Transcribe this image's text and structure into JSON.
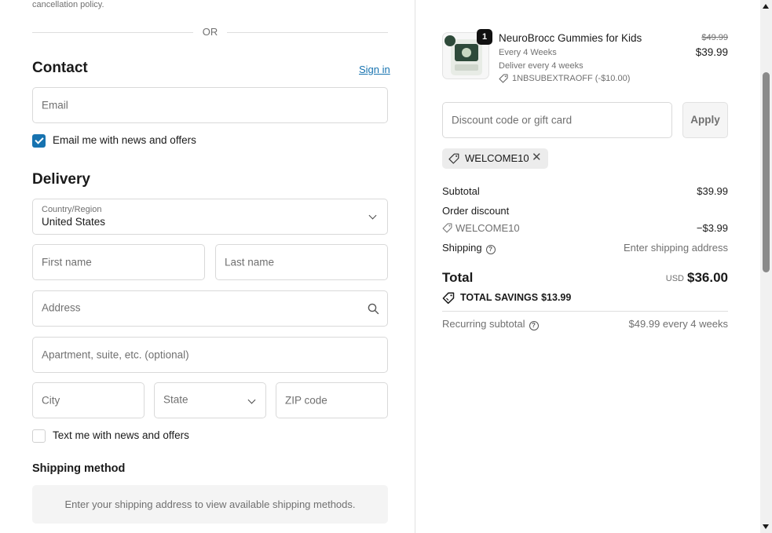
{
  "left": {
    "cancel_note": "cancellation policy.",
    "or_text": "OR",
    "contact": {
      "heading": "Contact",
      "sign_in": "Sign in",
      "email_placeholder": "Email",
      "email_news_label": "Email me with news and offers",
      "email_news_checked": true
    },
    "delivery": {
      "heading": "Delivery",
      "country_label": "Country/Region",
      "country_value": "United States",
      "first_name_placeholder": "First name",
      "last_name_placeholder": "Last name",
      "address_placeholder": "Address",
      "apartment_placeholder": "Apartment, suite, etc. (optional)",
      "city_placeholder": "City",
      "state_placeholder": "State",
      "zip_placeholder": "ZIP code",
      "text_news_label": "Text me with news and offers",
      "text_news_checked": false
    },
    "shipping_method": {
      "heading": "Shipping method",
      "message": "Enter your shipping address to view available shipping methods."
    }
  },
  "summary": {
    "product": {
      "quantity": "1",
      "name": "NeuroBrocc Gummies for Kids",
      "frequency": "Every 4 Weeks",
      "delivery_note": "Deliver every 4 weeks",
      "discount_code": "1NBSUBEXTRAOFF (-$10.00)",
      "original_price": "$49.99",
      "price": "$39.99"
    },
    "discount_placeholder": "Discount code or gift card",
    "apply_label": "Apply",
    "applied_code": "WELCOME10",
    "subtotal_label": "Subtotal",
    "subtotal_value": "$39.99",
    "order_discount_label": "Order discount",
    "order_discount_code": "WELCOME10",
    "order_discount_value": "−$3.99",
    "shipping_label": "Shipping",
    "shipping_value": "Enter shipping address",
    "total_label": "Total",
    "total_currency": "USD",
    "total_value": "$36.00",
    "savings_label": "TOTAL SAVINGS",
    "savings_value": "$13.99",
    "recurring_label": "Recurring subtotal",
    "recurring_value": "$49.99 every 4 weeks"
  },
  "colors": {
    "accent": "#1773b0",
    "border": "#d9d9d9",
    "muted_text": "#707070"
  }
}
